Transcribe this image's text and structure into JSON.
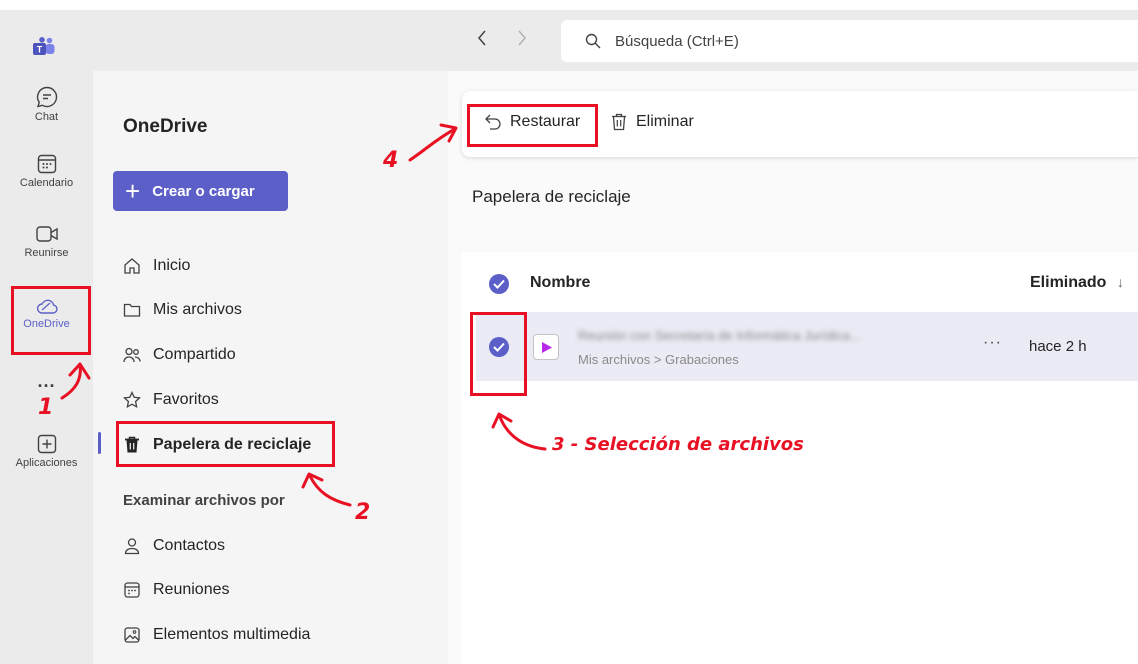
{
  "search": {
    "placeholder": "Búsqueda (Ctrl+E)"
  },
  "rail": {
    "chat": "Chat",
    "calendar": "Calendario",
    "meet": "Reunirse",
    "onedrive": "OneDrive",
    "more": "...",
    "apps": "Aplicaciones"
  },
  "sidebar": {
    "title": "OneDrive",
    "create_button": "Crear o cargar",
    "items": [
      {
        "label": "Inicio"
      },
      {
        "label": "Mis archivos"
      },
      {
        "label": "Compartido"
      },
      {
        "label": "Favoritos"
      },
      {
        "label": "Papelera de reciclaje"
      }
    ],
    "browse_label": "Examinar archivos por",
    "browse_items": [
      {
        "label": "Contactos"
      },
      {
        "label": "Reuniones"
      },
      {
        "label": "Elementos multimedia"
      }
    ]
  },
  "toolbar": {
    "restore_label": "Restaurar",
    "delete_label": "Eliminar"
  },
  "main": {
    "section_title": "Papelera de reciclaje",
    "columns": {
      "name": "Nombre",
      "deleted": "Eliminado",
      "sort_indicator": "↓"
    },
    "rows": [
      {
        "name": "Reunión con Secretaría de Informática Jurídica...",
        "path": "Mis archivos > Grabaciones",
        "more": "···",
        "deleted": "hace 2 h"
      }
    ]
  },
  "annotations": {
    "step1": "1",
    "step2": "2",
    "step3": "3 - Selección de archivos",
    "step4": "4"
  },
  "colors": {
    "accent": "#5b5fc7",
    "annotation": "#e81123"
  }
}
